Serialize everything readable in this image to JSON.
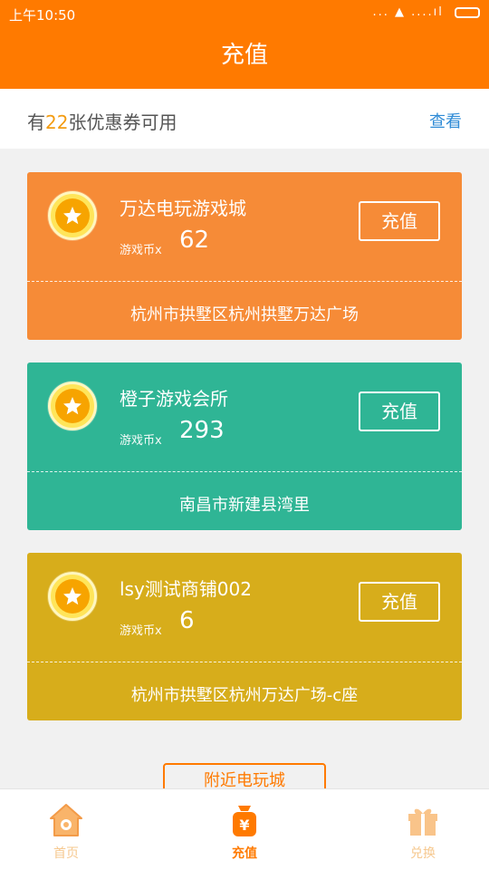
{
  "status_bar": {
    "time": "上午10:50",
    "signal": "... ▲ ....ıl"
  },
  "header": {
    "title": "充值"
  },
  "coupon": {
    "prefix": "有",
    "count": "22",
    "suffix": "张优惠券可用",
    "view_label": "查看"
  },
  "cards": [
    {
      "name": "万达电玩游戏城",
      "coins_label": "游戏币x",
      "coins_value": "62",
      "button_label": "充值",
      "address": "杭州市拱墅区杭州拱墅万达广场",
      "color": "#f68b37"
    },
    {
      "name": "橙子游戏会所",
      "coins_label": "游戏币x",
      "coins_value": "293",
      "button_label": "充值",
      "address": "南昌市新建县湾里",
      "color": "#2fb595"
    },
    {
      "name": "lsy测试商铺002",
      "coins_label": "游戏币x",
      "coins_value": "6",
      "button_label": "充值",
      "address": "杭州市拱墅区杭州万达广场-c座",
      "color": "#d7ad1b"
    }
  ],
  "nearby_button": {
    "label": "附近电玩城"
  },
  "tabs": [
    {
      "label": "首页",
      "icon": "home-icon"
    },
    {
      "label": "充值",
      "icon": "yuan-bag-icon"
    },
    {
      "label": "兑换",
      "icon": "gift-icon"
    }
  ],
  "colors": {
    "primary": "#ff7a00",
    "link": "#2f8bd6"
  }
}
